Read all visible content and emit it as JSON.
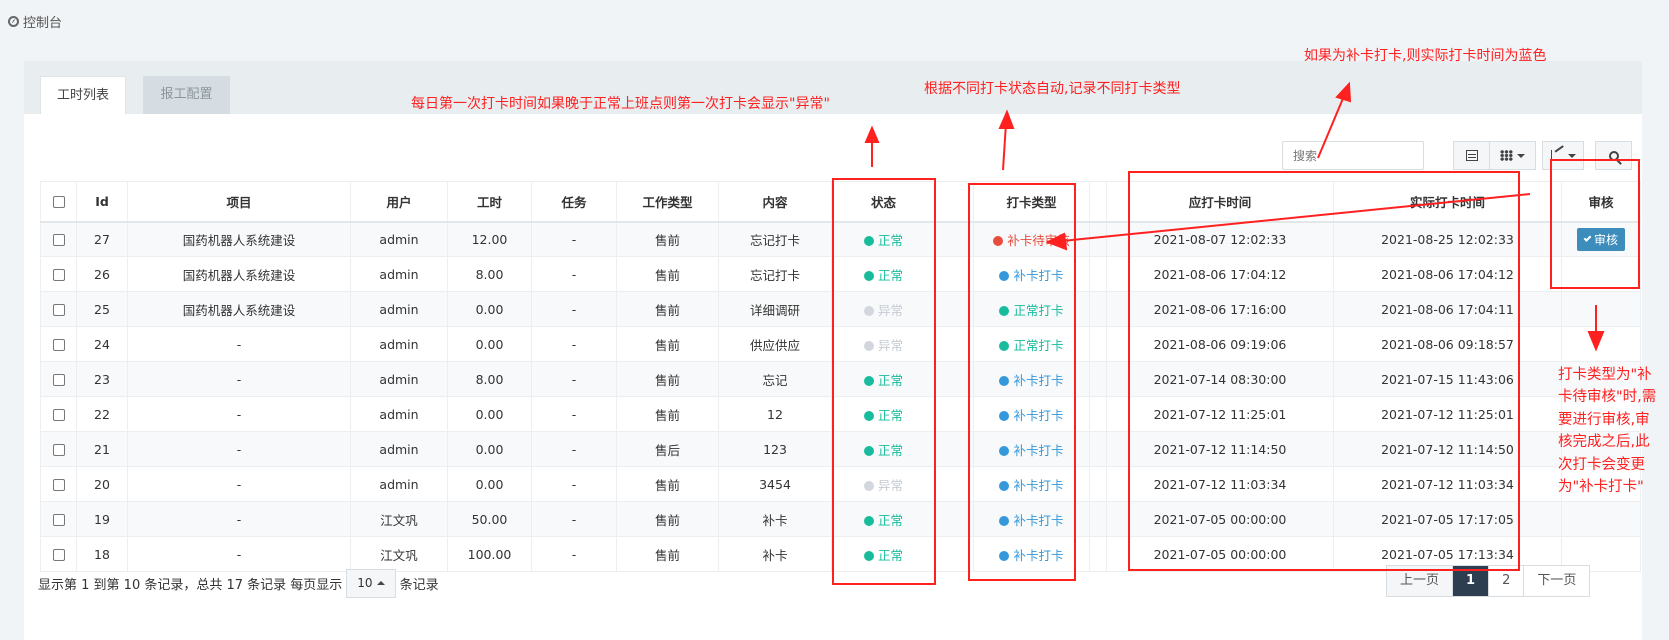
{
  "breadcrumb": "控制台",
  "tabs": [
    {
      "label": "工时列表",
      "active": true
    },
    {
      "label": "报工配置",
      "active": false
    }
  ],
  "search": {
    "placeholder": "搜索"
  },
  "table": {
    "columns": [
      "",
      "Id",
      "项目",
      "用户",
      "工时",
      "任务",
      "工作类型",
      "内容",
      "状态",
      "",
      "打卡类型",
      "",
      "应打卡时间",
      "实际打卡时间",
      "审核"
    ],
    "rows": [
      {
        "id": "27",
        "project": "国药机器人系统建设",
        "user": "admin",
        "hours": "12.00",
        "task": "-",
        "work_type": "售前",
        "content": "忘记打卡",
        "status": "正常",
        "status_color": "green",
        "punch_type": "补卡待审核",
        "punch_color": "red",
        "scheduled": "2021-08-07 12:02:33",
        "actual": "2021-08-25 12:02:33",
        "actual_blue": true,
        "audit": "审核"
      },
      {
        "id": "26",
        "project": "国药机器人系统建设",
        "user": "admin",
        "hours": "8.00",
        "task": "-",
        "work_type": "售前",
        "content": "忘记打卡",
        "status": "正常",
        "status_color": "green",
        "punch_type": "补卡打卡",
        "punch_color": "blue",
        "scheduled": "2021-08-06 17:04:12",
        "actual": "2021-08-06 17:04:12",
        "actual_blue": true,
        "audit": ""
      },
      {
        "id": "25",
        "project": "国药机器人系统建设",
        "user": "admin",
        "hours": "0.00",
        "task": "-",
        "work_type": "售前",
        "content": "详细调研",
        "status": "异常",
        "status_color": "grey",
        "punch_type": "正常打卡",
        "punch_color": "green",
        "scheduled": "2021-08-06 17:16:00",
        "actual": "2021-08-06 17:04:11",
        "actual_blue": false,
        "audit": ""
      },
      {
        "id": "24",
        "project": "-",
        "user": "admin",
        "hours": "0.00",
        "task": "-",
        "work_type": "售前",
        "content": "供应供应",
        "status": "异常",
        "status_color": "grey",
        "punch_type": "正常打卡",
        "punch_color": "green",
        "scheduled": "2021-08-06 09:19:06",
        "actual": "2021-08-06 09:18:57",
        "actual_blue": false,
        "audit": ""
      },
      {
        "id": "23",
        "project": "-",
        "user": "admin",
        "hours": "8.00",
        "task": "-",
        "work_type": "售前",
        "content": "忘记",
        "status": "正常",
        "status_color": "green",
        "punch_type": "补卡打卡",
        "punch_color": "blue",
        "scheduled": "2021-07-14 08:30:00",
        "actual": "2021-07-15 11:43:06",
        "actual_blue": true,
        "audit": ""
      },
      {
        "id": "22",
        "project": "-",
        "user": "admin",
        "hours": "0.00",
        "task": "-",
        "work_type": "售前",
        "content": "12",
        "status": "正常",
        "status_color": "green",
        "punch_type": "补卡打卡",
        "punch_color": "blue",
        "scheduled": "2021-07-12 11:25:01",
        "actual": "2021-07-12 11:25:01",
        "actual_blue": true,
        "audit": ""
      },
      {
        "id": "21",
        "project": "-",
        "user": "admin",
        "hours": "0.00",
        "task": "-",
        "work_type": "售后",
        "content": "123",
        "status": "正常",
        "status_color": "green",
        "punch_type": "补卡打卡",
        "punch_color": "blue",
        "scheduled": "2021-07-12 11:14:50",
        "actual": "2021-07-12 11:14:50",
        "actual_blue": true,
        "audit": ""
      },
      {
        "id": "20",
        "project": "-",
        "user": "admin",
        "hours": "0.00",
        "task": "-",
        "work_type": "售前",
        "content": "3454",
        "status": "异常",
        "status_color": "grey",
        "punch_type": "补卡打卡",
        "punch_color": "blue",
        "scheduled": "2021-07-12 11:03:34",
        "actual": "2021-07-12 11:03:34",
        "actual_blue": true,
        "audit": ""
      },
      {
        "id": "19",
        "project": "-",
        "user": "江文巩",
        "hours": "50.00",
        "task": "-",
        "work_type": "售前",
        "content": "补卡",
        "status": "正常",
        "status_color": "green",
        "punch_type": "补卡打卡",
        "punch_color": "blue",
        "scheduled": "2021-07-05 00:00:00",
        "actual": "2021-07-05 17:17:05",
        "actual_blue": true,
        "audit": ""
      },
      {
        "id": "18",
        "project": "-",
        "user": "江文巩",
        "hours": "100.00",
        "task": "-",
        "work_type": "售前",
        "content": "补卡",
        "status": "正常",
        "status_color": "green",
        "punch_type": "补卡打卡",
        "punch_color": "blue",
        "scheduled": "2021-07-05 00:00:00",
        "actual": "2021-07-05 17:13:34",
        "actual_blue": true,
        "audit": ""
      }
    ]
  },
  "footer": {
    "info_before": "显示第 1 到第 10 条记录，总共 17 条记录 每页显示",
    "page_size": "10",
    "info_after": "条记录",
    "pages": [
      "上一页",
      "1",
      "2",
      "下一页"
    ],
    "current_page": "1"
  },
  "annotations": {
    "status_note": "每日第一次打卡时间如果晚于正常上班点则第一次打卡会显示\"异常\"",
    "punch_type_note": "根据不同打卡状态自动,记录不同打卡类型",
    "actual_time_note": "如果为补卡打卡,则实际打卡时间为蓝色",
    "audit_note": "打卡类型为\"补卡待审核\"时,需要进行审核,审核完成之后,此次打卡会变更为\"补卡打卡\"",
    "color": "#ff2020"
  },
  "colors": {
    "accent_green": "#18bc9c",
    "accent_blue": "#3498db",
    "accent_red": "#e74c3c",
    "audit_button": "#3c8dbc",
    "active_page": "#2c3e50"
  }
}
